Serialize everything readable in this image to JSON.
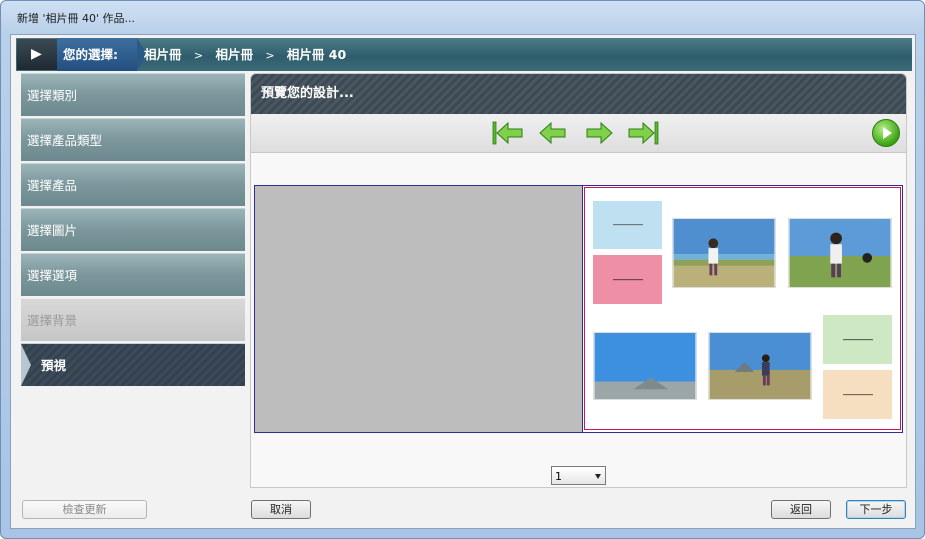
{
  "window": {
    "title": "新增 '相片冊 40' 作品..."
  },
  "breadcrumb": {
    "label": "您的選擇:",
    "items": [
      "相片冊",
      "相片冊",
      "相片冊 40"
    ],
    "separator": ">"
  },
  "sidebar": {
    "items": [
      {
        "label": "選擇類別",
        "state": "normal"
      },
      {
        "label": "選擇產品類型",
        "state": "normal"
      },
      {
        "label": "選擇產品",
        "state": "normal"
      },
      {
        "label": "選擇圖片",
        "state": "normal"
      },
      {
        "label": "選擇選項",
        "state": "normal"
      },
      {
        "label": "選擇背景",
        "state": "disabled"
      },
      {
        "label": "預視",
        "state": "active"
      }
    ]
  },
  "preview": {
    "header": "預覽您的設計...",
    "nav_icons": [
      "first-page-icon",
      "prev-page-icon",
      "next-page-icon",
      "last-page-icon"
    ],
    "play_icon": "play-icon",
    "page_select": {
      "value": "1"
    }
  },
  "footer": {
    "check_updates": "檢查更新",
    "cancel": "取消",
    "back": "返回",
    "next": "下一步"
  },
  "colors": {
    "nav_arrow_green": "#5bb82e",
    "card_blue": "#bfe0f0",
    "card_pink": "#ef8fa6",
    "card_green": "#cfe8c4",
    "card_peach": "#f6dfc1",
    "page_border": "#d4145a",
    "spread_border": "#2d2d9c"
  }
}
